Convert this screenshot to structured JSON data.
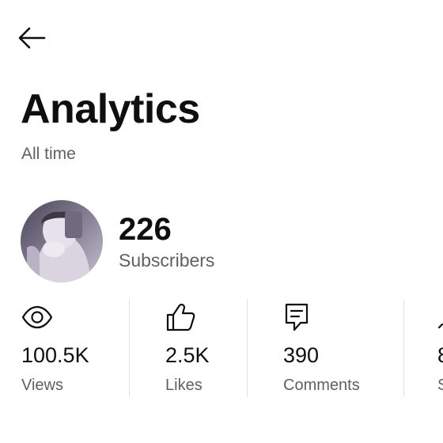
{
  "header": {
    "back_icon": "arrow-left-icon",
    "title": "Analytics",
    "subtitle": "All time"
  },
  "channel": {
    "avatar_icon": "avatar",
    "subscribers_value": "226",
    "subscribers_label": "Subscribers"
  },
  "metrics": [
    {
      "icon": "eye-icon",
      "value": "100.5K",
      "label": "Views"
    },
    {
      "icon": "thumbs-up-icon",
      "value": "2.5K",
      "label": "Likes"
    },
    {
      "icon": "comment-icon",
      "value": "390",
      "label": "Comments"
    },
    {
      "icon": "share-icon",
      "value": "8",
      "label": "S"
    }
  ],
  "colors": {
    "primary_text": "#0f0f0f",
    "secondary_text": "#606060",
    "divider": "#e2e2e2",
    "background": "#ffffff"
  }
}
